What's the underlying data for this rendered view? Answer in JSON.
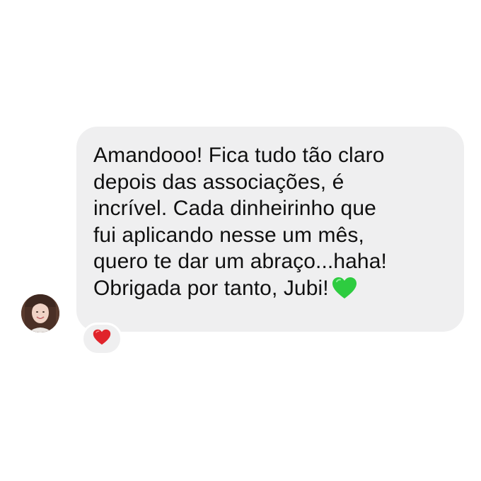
{
  "message": {
    "text": "Amandooo! Fica tudo tão claro\ndepois das associações, é\nincrível. Cada dinheirinho que\nfui aplicando nesse um mês,\nquero te dar um abraço...haha!\nObrigada por tanto, Jubi!",
    "trailing_emoji": "green-heart-emoji",
    "bubble_color": "#efeff0",
    "text_color": "#101010"
  },
  "sender": {
    "avatar": "profile-photo"
  },
  "reaction": {
    "emoji": "red-heart-emoji",
    "color": "#e0242b"
  },
  "colors": {
    "background": "#ffffff",
    "green_heart": "#2ecc40"
  }
}
